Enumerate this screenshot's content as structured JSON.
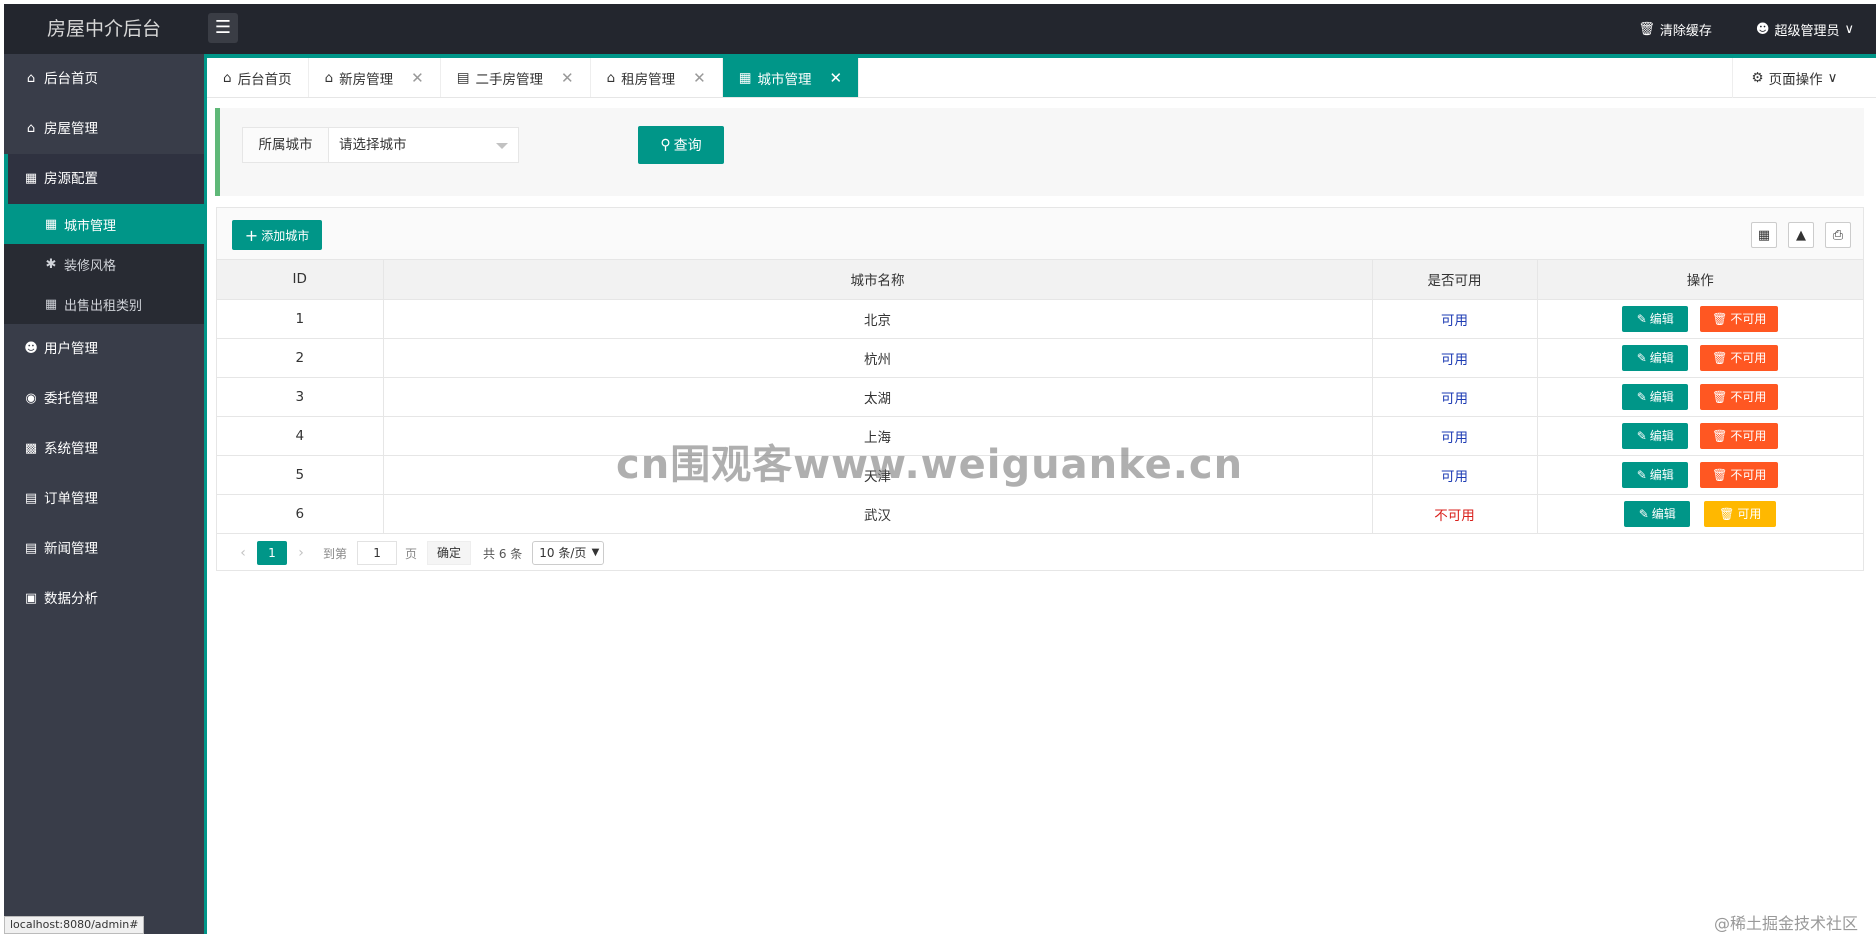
{
  "header": {
    "logo": "房屋中介后台",
    "clear_cache": "清除缓存",
    "admin": "超级管理员"
  },
  "sidebar": {
    "items": [
      {
        "label": "后台首页",
        "icon": "home-icon"
      },
      {
        "label": "房屋管理",
        "icon": "house-icon"
      },
      {
        "label": "房源配置",
        "icon": "building-icon"
      },
      {
        "label": "用户管理",
        "icon": "user-icon"
      },
      {
        "label": "委托管理",
        "icon": "entrust-icon"
      },
      {
        "label": "系统管理",
        "icon": "system-icon"
      },
      {
        "label": "订单管理",
        "icon": "order-icon"
      },
      {
        "label": "新闻管理",
        "icon": "news-icon"
      },
      {
        "label": "数据分析",
        "icon": "chart-icon"
      }
    ],
    "sub_items": [
      {
        "label": "城市管理"
      },
      {
        "label": "装修风格"
      },
      {
        "label": "出售出租类别"
      }
    ],
    "status_url": "localhost:8080/admin#"
  },
  "tabs": [
    {
      "label": "后台首页"
    },
    {
      "label": "新房管理"
    },
    {
      "label": "二手房管理"
    },
    {
      "label": "租房管理"
    },
    {
      "label": "城市管理"
    }
  ],
  "page_ops": "页面操作",
  "search": {
    "label": "所属城市",
    "placeholder": "请选择城市",
    "query_button": "查询"
  },
  "toolbar": {
    "add_button": "添加城市"
  },
  "table": {
    "headers": {
      "id": "ID",
      "name": "城市名称",
      "status": "是否可用",
      "ops": "操作"
    },
    "edit_label": "编辑",
    "disable_label": "不可用",
    "enable_label": "可用",
    "rows": [
      {
        "id": "1",
        "name": "北京",
        "status": "可用"
      },
      {
        "id": "2",
        "name": "杭州",
        "status": "可用"
      },
      {
        "id": "3",
        "name": "太湖",
        "status": "可用"
      },
      {
        "id": "4",
        "name": "上海",
        "status": "可用"
      },
      {
        "id": "5",
        "name": "天津",
        "status": "可用"
      },
      {
        "id": "6",
        "name": "武汉",
        "status": "不可用"
      }
    ]
  },
  "pager": {
    "current": "1",
    "goto": "到第",
    "page_input": "1",
    "page_unit": "页",
    "confirm": "确定",
    "total": "共 6 条",
    "page_size": "10 条/页"
  },
  "watermark": "cn围观客www.weiguanke.cn",
  "corner_mark": "@稀土掘金技术社区",
  "colors": {
    "primary": "#009688",
    "danger": "#ff5722",
    "warn": "#ffb800",
    "sidebar": "#393d49",
    "header": "#23262e"
  }
}
